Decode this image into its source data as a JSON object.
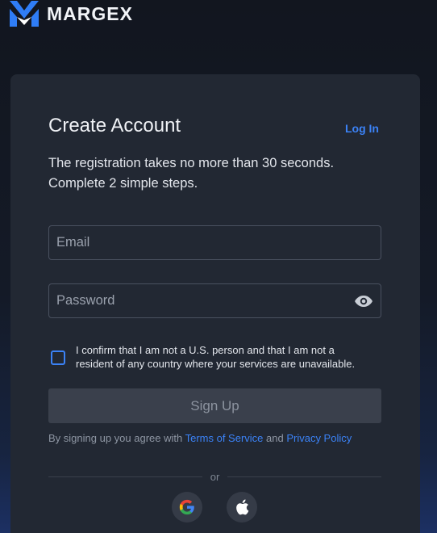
{
  "brand": {
    "name": "MARGEX",
    "logo_icon": "margex-logo-icon",
    "accent": "#3b82f6"
  },
  "card": {
    "title": "Create Account",
    "login_link": "Log In",
    "subtitle_line1": "The registration takes no more than 30 seconds.",
    "subtitle_line2": "Complete 2 simple steps."
  },
  "form": {
    "email_placeholder": "Email",
    "email_value": "",
    "password_placeholder": "Password",
    "password_value": "",
    "password_toggle_icon": "eye-icon",
    "confirm_line1": "I confirm that I am not a U.S. person and that I am not a",
    "confirm_line2": "resident of any country where your services are unavailable.",
    "confirm_checked": false,
    "signup_label": "Sign Up",
    "agree_prefix": "By signing up you agree with ",
    "terms_label": "Terms of Service",
    "agree_and": " and ",
    "privacy_label": "Privacy Policy",
    "or_label": "or"
  },
  "social": [
    {
      "name": "google",
      "icon": "google-icon"
    },
    {
      "name": "apple",
      "icon": "apple-icon"
    }
  ]
}
